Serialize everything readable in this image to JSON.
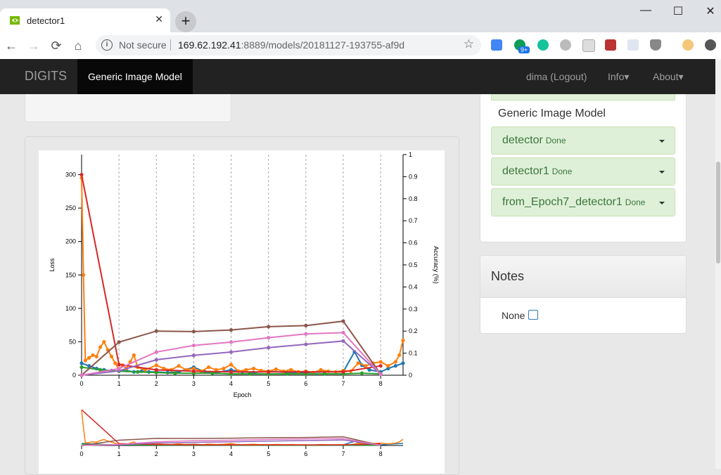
{
  "browser": {
    "tab_title": "detector1",
    "new_tab": "+",
    "window_controls": {
      "minimize": "—",
      "maximize": "☐",
      "close": "✕"
    },
    "nav": {
      "back": "←",
      "forward": "→",
      "reload": "⟳",
      "home": "⌂"
    },
    "security_label": "Not secure",
    "url_host": "169.62.192.41",
    "url_rest": ":8889/models/20181127-193755-af9d",
    "badge": "9+"
  },
  "app": {
    "brand": "DIGITS",
    "active_tab": "Generic Image Model",
    "user_link": "dima (Logout)",
    "info_menu": "Info▾",
    "about_menu": "About▾"
  },
  "sidebar": {
    "group_title": "Generic Image Model",
    "jobs": [
      {
        "name": "detector",
        "status": "Done"
      },
      {
        "name": "detector1",
        "status": "Done"
      },
      {
        "name": "from_Epoch7_detector1",
        "status": "Done"
      }
    ]
  },
  "notes": {
    "title": "Notes",
    "value": "None"
  },
  "colors": {
    "blue": "#1f77b4",
    "orange": "#ff7f0e",
    "green": "#2ca02c",
    "red": "#d62728",
    "purple": "#9467bd",
    "brown": "#8c564b",
    "pink": "#e377c2"
  },
  "chart_data": {
    "type": "line",
    "xlabel": "Epoch",
    "ylabel": "Loss",
    "y2label": "Accuracy (%)",
    "xlim": [
      0,
      8.6
    ],
    "ylim": [
      0,
      330
    ],
    "y2lim": [
      0,
      1
    ],
    "x_ticks": [
      0,
      1,
      2,
      3,
      4,
      5,
      6,
      7,
      8
    ],
    "y_ticks": [
      0,
      50,
      100,
      150,
      200,
      250,
      300
    ],
    "y2_ticks": [
      0,
      0.1,
      0.2,
      0.3,
      0.4,
      0.5,
      0.6,
      0.7,
      0.8,
      0.9,
      1
    ],
    "grid_x": true,
    "series": [
      {
        "color": "blue",
        "axis": "y",
        "dots": true,
        "points": [
          [
            0,
            18
          ],
          [
            0.2,
            14
          ],
          [
            0.4,
            10
          ],
          [
            0.6,
            8
          ],
          [
            0.8,
            7
          ],
          [
            1,
            6
          ],
          [
            1.2,
            7
          ],
          [
            1.4,
            5
          ],
          [
            1.6,
            6
          ],
          [
            1.8,
            5
          ],
          [
            2,
            5
          ],
          [
            2.3,
            4
          ],
          [
            2.6,
            5
          ],
          [
            3,
            12
          ],
          [
            3.3,
            5
          ],
          [
            3.6,
            4
          ],
          [
            4,
            8
          ],
          [
            4.3,
            5
          ],
          [
            4.6,
            4
          ],
          [
            5,
            6
          ],
          [
            5.5,
            4
          ],
          [
            6,
            4
          ],
          [
            6.5,
            5
          ],
          [
            7,
            5
          ],
          [
            7.3,
            35
          ],
          [
            7.5,
            15
          ],
          [
            7.7,
            8
          ],
          [
            8,
            5
          ],
          [
            8.2,
            10
          ],
          [
            8.4,
            14
          ],
          [
            8.6,
            18
          ]
        ]
      },
      {
        "color": "orange",
        "axis": "y",
        "dots": true,
        "points": [
          [
            0,
            295
          ],
          [
            0.05,
            150
          ],
          [
            0.1,
            22
          ],
          [
            0.2,
            26
          ],
          [
            0.3,
            30
          ],
          [
            0.4,
            28
          ],
          [
            0.5,
            42
          ],
          [
            0.6,
            50
          ],
          [
            0.7,
            38
          ],
          [
            0.8,
            28
          ],
          [
            0.9,
            18
          ],
          [
            1,
            8
          ],
          [
            1.1,
            15
          ],
          [
            1.2,
            10
          ],
          [
            1.3,
            20
          ],
          [
            1.4,
            30
          ],
          [
            1.5,
            12
          ],
          [
            1.7,
            8
          ],
          [
            2,
            15
          ],
          [
            2.2,
            10
          ],
          [
            2.4,
            8
          ],
          [
            2.6,
            14
          ],
          [
            2.8,
            8
          ],
          [
            3,
            10
          ],
          [
            3.2,
            6
          ],
          [
            3.4,
            12
          ],
          [
            3.6,
            8
          ],
          [
            3.8,
            10
          ],
          [
            4,
            16
          ],
          [
            4.2,
            6
          ],
          [
            4.4,
            8
          ],
          [
            4.6,
            10
          ],
          [
            4.8,
            7
          ],
          [
            5,
            6
          ],
          [
            5.2,
            9
          ],
          [
            5.4,
            6
          ],
          [
            5.6,
            8
          ],
          [
            5.8,
            5
          ],
          [
            6,
            6
          ],
          [
            6.2,
            4
          ],
          [
            6.4,
            8
          ],
          [
            6.6,
            6
          ],
          [
            6.8,
            5
          ],
          [
            7,
            7
          ],
          [
            7.2,
            6
          ],
          [
            7.4,
            18
          ],
          [
            7.6,
            14
          ],
          [
            7.8,
            18
          ],
          [
            8,
            20
          ],
          [
            8.2,
            14
          ],
          [
            8.4,
            20
          ],
          [
            8.5,
            30
          ],
          [
            8.6,
            52
          ]
        ]
      },
      {
        "color": "green",
        "axis": "y",
        "dots": true,
        "points": [
          [
            0,
            12
          ],
          [
            0.5,
            8
          ],
          [
            1,
            6
          ],
          [
            1.5,
            5
          ],
          [
            2,
            4
          ],
          [
            2.5,
            3
          ],
          [
            3,
            3
          ],
          [
            3.5,
            3
          ],
          [
            4,
            2
          ],
          [
            4.5,
            2
          ],
          [
            5,
            2
          ],
          [
            5.5,
            2
          ],
          [
            6,
            2
          ],
          [
            6.5,
            2
          ],
          [
            7,
            2
          ],
          [
            7.5,
            3
          ],
          [
            8,
            2
          ]
        ]
      },
      {
        "color": "red",
        "axis": "y",
        "dots": true,
        "points": [
          [
            0,
            300
          ],
          [
            1,
            16
          ],
          [
            2,
            8
          ],
          [
            3,
            6
          ],
          [
            4,
            5
          ],
          [
            5,
            5
          ],
          [
            6,
            5
          ],
          [
            7,
            5
          ],
          [
            8,
            14
          ]
        ]
      },
      {
        "color": "purple",
        "axis": "y2",
        "dots": true,
        "points": [
          [
            0,
            0
          ],
          [
            1,
            0.02
          ],
          [
            2,
            0.07
          ],
          [
            3,
            0.09
          ],
          [
            4,
            0.105
          ],
          [
            5,
            0.125
          ],
          [
            6,
            0.14
          ],
          [
            7,
            0.155
          ],
          [
            8,
            0.005
          ]
        ]
      },
      {
        "color": "brown",
        "axis": "y2",
        "dots": true,
        "points": [
          [
            0,
            0
          ],
          [
            1,
            0.15
          ],
          [
            2,
            0.2
          ],
          [
            3,
            0.198
          ],
          [
            4,
            0.205
          ],
          [
            5,
            0.22
          ],
          [
            6,
            0.225
          ],
          [
            7,
            0.245
          ],
          [
            8,
            0.005
          ]
        ]
      },
      {
        "color": "pink",
        "axis": "y2",
        "dots": true,
        "points": [
          [
            0,
            0
          ],
          [
            1,
            0.03
          ],
          [
            2,
            0.105
          ],
          [
            3,
            0.135
          ],
          [
            4,
            0.15
          ],
          [
            5,
            0.17
          ],
          [
            6,
            0.187
          ],
          [
            7,
            0.193
          ],
          [
            8,
            0.005
          ]
        ]
      }
    ]
  }
}
